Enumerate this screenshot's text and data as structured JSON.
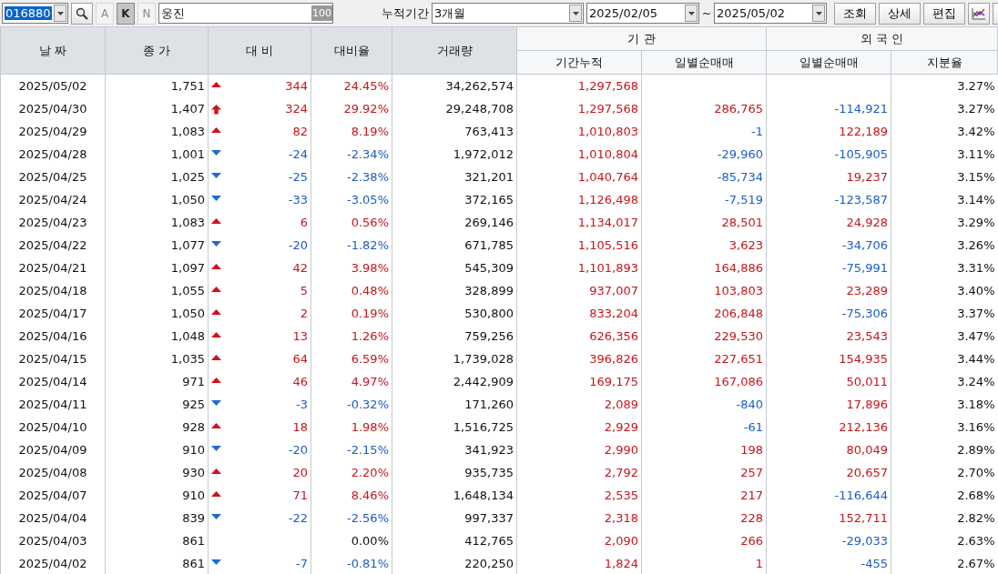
{
  "toolbar": {
    "code": "016880",
    "code_selected": true,
    "letters": [
      {
        "label": "A",
        "disabled": true,
        "selected": false
      },
      {
        "label": "K",
        "disabled": false,
        "selected": true
      },
      {
        "label": "N",
        "disabled": true,
        "selected": false
      }
    ],
    "name": "웅진",
    "name_badge": "100",
    "period_label": "누적기간",
    "period": "3개월",
    "date_from": "2025/02/05",
    "date_sep": "~",
    "date_to": "2025/05/02",
    "buttons": [
      "조회",
      "상세",
      "편집"
    ]
  },
  "table": {
    "columns": [
      "날 짜",
      "종 가",
      "대 비",
      "대비율",
      "거래량"
    ],
    "groups": [
      {
        "label": "기    관",
        "columns": [
          "기간누적",
          "일별순매매"
        ]
      },
      {
        "label": "외 국 인",
        "columns": [
          "일별순매매",
          "지분율"
        ]
      }
    ],
    "rows": [
      {
        "date": "2025/05/02",
        "close": "1,751",
        "kind": "up",
        "change": "344",
        "rate": "24.45%",
        "volume": "34,262,574",
        "inst_cum": "1,297,568",
        "share": "3.27%"
      },
      {
        "date": "2025/04/30",
        "close": "1,407",
        "kind": "limit",
        "change": "324",
        "rate": "29.92%",
        "volume": "29,248,708",
        "inst_cum": "1,297,568",
        "inst_daily": "286,765",
        "inst_up": true,
        "frgn_daily": "-114,921",
        "frgn_up": false,
        "share": "3.27%"
      },
      {
        "date": "2025/04/29",
        "close": "1,083",
        "kind": "up",
        "change": "82",
        "rate": "8.19%",
        "volume": "763,413",
        "inst_cum": "1,010,803",
        "inst_daily": "-1",
        "inst_up": false,
        "frgn_daily": "122,189",
        "frgn_up": true,
        "share": "3.42%"
      },
      {
        "date": "2025/04/28",
        "close": "1,001",
        "kind": "down",
        "change": "-24",
        "rate": "-2.34%",
        "volume": "1,972,012",
        "inst_cum": "1,010,804",
        "inst_daily": "-29,960",
        "inst_up": false,
        "frgn_daily": "-105,905",
        "frgn_up": false,
        "share": "3.11%"
      },
      {
        "date": "2025/04/25",
        "close": "1,025",
        "kind": "down",
        "change": "-25",
        "rate": "-2.38%",
        "volume": "321,201",
        "inst_cum": "1,040,764",
        "inst_daily": "-85,734",
        "inst_up": false,
        "frgn_daily": "19,237",
        "frgn_up": true,
        "share": "3.15%"
      },
      {
        "date": "2025/04/24",
        "close": "1,050",
        "kind": "down",
        "change": "-33",
        "rate": "-3.05%",
        "volume": "372,165",
        "inst_cum": "1,126,498",
        "inst_daily": "-7,519",
        "inst_up": false,
        "frgn_daily": "-123,587",
        "frgn_up": false,
        "share": "3.14%"
      },
      {
        "date": "2025/04/23",
        "close": "1,083",
        "kind": "up",
        "change": "6",
        "rate": "0.56%",
        "volume": "269,146",
        "inst_cum": "1,134,017",
        "inst_daily": "28,501",
        "inst_up": true,
        "frgn_daily": "24,928",
        "frgn_up": true,
        "share": "3.29%"
      },
      {
        "date": "2025/04/22",
        "close": "1,077",
        "kind": "down",
        "change": "-20",
        "rate": "-1.82%",
        "volume": "671,785",
        "inst_cum": "1,105,516",
        "inst_daily": "3,623",
        "inst_up": true,
        "frgn_daily": "-34,706",
        "frgn_up": false,
        "share": "3.26%"
      },
      {
        "date": "2025/04/21",
        "close": "1,097",
        "kind": "up",
        "change": "42",
        "rate": "3.98%",
        "volume": "545,309",
        "inst_cum": "1,101,893",
        "inst_daily": "164,886",
        "inst_up": true,
        "frgn_daily": "-75,991",
        "frgn_up": false,
        "share": "3.31%"
      },
      {
        "date": "2025/04/18",
        "close": "1,055",
        "kind": "up",
        "change": "5",
        "rate": "0.48%",
        "volume": "328,899",
        "inst_cum": "937,007",
        "inst_daily": "103,803",
        "inst_up": true,
        "frgn_daily": "23,289",
        "frgn_up": true,
        "share": "3.40%"
      },
      {
        "date": "2025/04/17",
        "close": "1,050",
        "kind": "up",
        "change": "2",
        "rate": "0.19%",
        "volume": "530,800",
        "inst_cum": "833,204",
        "inst_daily": "206,848",
        "inst_up": true,
        "frgn_daily": "-75,306",
        "frgn_up": false,
        "share": "3.37%"
      },
      {
        "date": "2025/04/16",
        "close": "1,048",
        "kind": "up",
        "change": "13",
        "rate": "1.26%",
        "volume": "759,256",
        "inst_cum": "626,356",
        "inst_daily": "229,530",
        "inst_up": true,
        "frgn_daily": "23,543",
        "frgn_up": true,
        "share": "3.47%"
      },
      {
        "date": "2025/04/15",
        "close": "1,035",
        "kind": "up",
        "change": "64",
        "rate": "6.59%",
        "volume": "1,739,028",
        "inst_cum": "396,826",
        "inst_daily": "227,651",
        "inst_up": true,
        "frgn_daily": "154,935",
        "frgn_up": true,
        "share": "3.44%"
      },
      {
        "date": "2025/04/14",
        "close": "971",
        "kind": "up",
        "change": "46",
        "rate": "4.97%",
        "volume": "2,442,909",
        "inst_cum": "169,175",
        "inst_daily": "167,086",
        "inst_up": true,
        "frgn_daily": "50,011",
        "frgn_up": true,
        "share": "3.24%"
      },
      {
        "date": "2025/04/11",
        "close": "925",
        "kind": "down",
        "change": "-3",
        "rate": "-0.32%",
        "volume": "171,260",
        "inst_cum": "2,089",
        "inst_daily": "-840",
        "inst_up": false,
        "frgn_daily": "17,896",
        "frgn_up": true,
        "share": "3.18%"
      },
      {
        "date": "2025/04/10",
        "close": "928",
        "kind": "up",
        "change": "18",
        "rate": "1.98%",
        "volume": "1,516,725",
        "inst_cum": "2,929",
        "inst_daily": "-61",
        "inst_up": false,
        "frgn_daily": "212,136",
        "frgn_up": true,
        "share": "3.16%"
      },
      {
        "date": "2025/04/09",
        "close": "910",
        "kind": "down",
        "change": "-20",
        "rate": "-2.15%",
        "volume": "341,923",
        "inst_cum": "2,990",
        "inst_daily": "198",
        "inst_up": true,
        "frgn_daily": "80,049",
        "frgn_up": true,
        "share": "2.89%"
      },
      {
        "date": "2025/04/08",
        "close": "930",
        "kind": "up",
        "change": "20",
        "rate": "2.20%",
        "volume": "935,735",
        "inst_cum": "2,792",
        "inst_daily": "257",
        "inst_up": true,
        "frgn_daily": "20,657",
        "frgn_up": true,
        "share": "2.70%"
      },
      {
        "date": "2025/04/07",
        "close": "910",
        "kind": "up",
        "change": "71",
        "rate": "8.46%",
        "volume": "1,648,134",
        "inst_cum": "2,535",
        "inst_daily": "217",
        "inst_up": true,
        "frgn_daily": "-116,644",
        "frgn_up": false,
        "share": "2.68%"
      },
      {
        "date": "2025/04/04",
        "close": "839",
        "kind": "down",
        "change": "-22",
        "rate": "-2.56%",
        "volume": "997,337",
        "inst_cum": "2,318",
        "inst_daily": "228",
        "inst_up": true,
        "frgn_daily": "152,711",
        "frgn_up": true,
        "share": "2.82%"
      },
      {
        "date": "2025/04/03",
        "close": "861",
        "kind": "flat",
        "rate": "0.00%",
        "volume": "412,765",
        "inst_cum": "2,090",
        "inst_daily": "266",
        "inst_up": true,
        "frgn_daily": "-29,033",
        "frgn_up": false,
        "share": "2.63%"
      },
      {
        "date": "2025/04/02",
        "close": "861",
        "kind": "down",
        "change": "-7",
        "rate": "-0.81%",
        "volume": "220,250",
        "inst_cum": "1,824",
        "inst_daily": "1",
        "inst_up": true,
        "frgn_daily": "-455",
        "frgn_up": false,
        "share": "2.67%"
      }
    ]
  }
}
